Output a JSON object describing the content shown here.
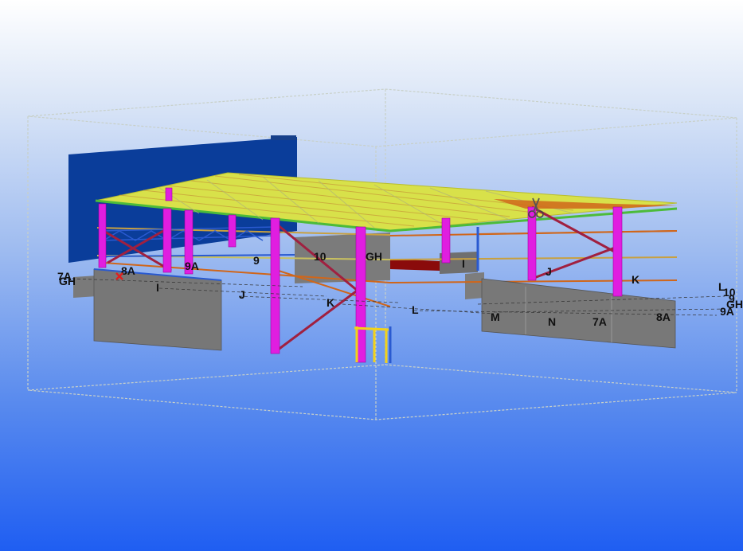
{
  "viewport": {
    "name": "3d-model-view",
    "background_top": "#ffffff",
    "background_bottom": "#1f5ef2"
  },
  "colors": {
    "roof": "#d8e14a",
    "roof_edge": "#4cbb3a",
    "column": "#e01ee0",
    "wall_panel": "#787878",
    "wall_blue": "#0a3d9a",
    "brace": "#a02040",
    "purlin_orange": "#d0661a",
    "beam_blue": "#2a5ad0",
    "door_yellow": "#f2d21a",
    "bounding_box": "#c8d0c8"
  },
  "icons": {
    "cut": "scissors-icon",
    "marker": "red-cross-marker-icon"
  },
  "grid_labels": [
    {
      "id": "7a-left",
      "text": "7A"
    },
    {
      "id": "gh-left",
      "text": "GH"
    },
    {
      "id": "8a-left",
      "text": "8A"
    },
    {
      "id": "9a-mid",
      "text": "9A"
    },
    {
      "id": "9",
      "text": "9"
    },
    {
      "id": "10",
      "text": "10"
    },
    {
      "id": "gh-mid",
      "text": "GH"
    },
    {
      "id": "i-left",
      "text": "I"
    },
    {
      "id": "i-mid",
      "text": "I"
    },
    {
      "id": "j-left",
      "text": "J"
    },
    {
      "id": "j-right",
      "text": "J"
    },
    {
      "id": "k-left",
      "text": "K"
    },
    {
      "id": "k-right",
      "text": "K"
    },
    {
      "id": "l-mid",
      "text": "L"
    },
    {
      "id": "m",
      "text": "M"
    },
    {
      "id": "n",
      "text": "N"
    },
    {
      "id": "7a-right",
      "text": "7A"
    },
    {
      "id": "8a-right",
      "text": "8A"
    },
    {
      "id": "l-far",
      "text": "L"
    },
    {
      "id": "10-far",
      "text": "10"
    },
    {
      "id": "9a-far",
      "text": "9A"
    },
    {
      "id": "9-far",
      "text": "9"
    },
    {
      "id": "gh-far",
      "text": "GH"
    }
  ]
}
